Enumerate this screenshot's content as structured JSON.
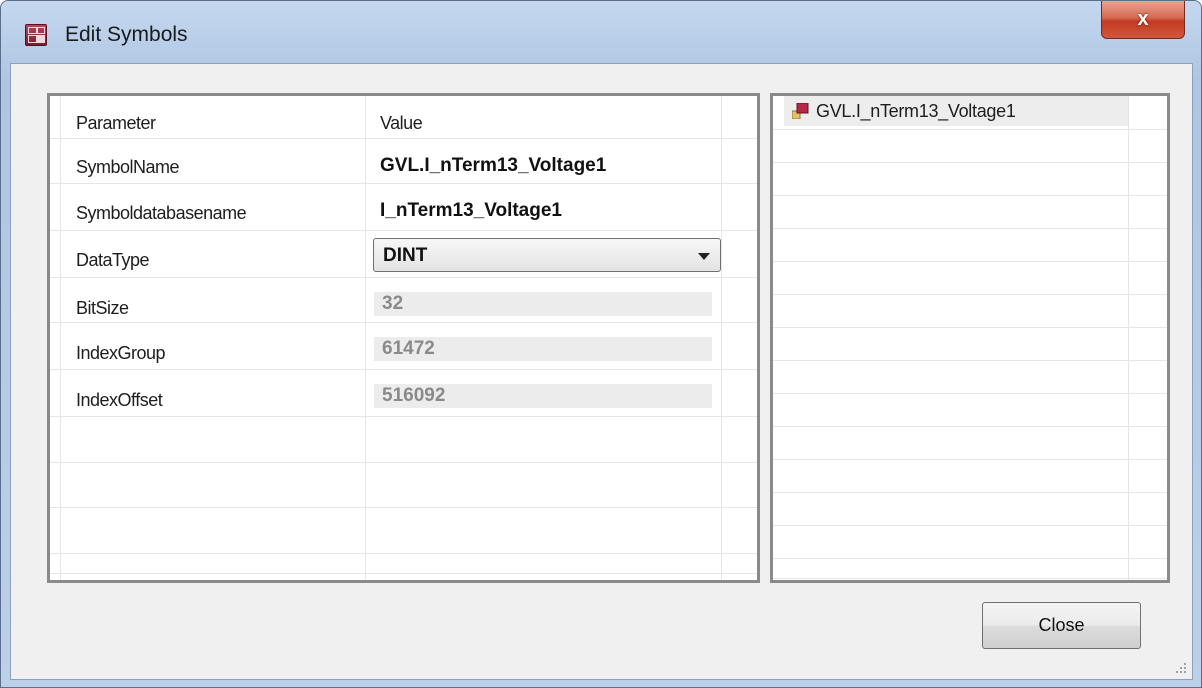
{
  "window": {
    "title": "Edit Symbols",
    "close_glyph": "x"
  },
  "grid": {
    "headers": {
      "parameter": "Parameter",
      "value": "Value"
    },
    "rows": [
      {
        "param": "SymbolName",
        "value": "GVL.I_nTerm13_Voltage1",
        "kind": "text"
      },
      {
        "param": "Symboldatabasename",
        "value": "I_nTerm13_Voltage1",
        "kind": "text"
      },
      {
        "param": "DataType",
        "value": "DINT",
        "kind": "combo"
      },
      {
        "param": "BitSize",
        "value": "32",
        "kind": "readonly"
      },
      {
        "param": "IndexGroup",
        "value": "61472",
        "kind": "readonly"
      },
      {
        "param": "IndexOffset",
        "value": "516092",
        "kind": "readonly"
      }
    ]
  },
  "tree": {
    "items": [
      {
        "label": "GVL.I_nTerm13_Voltage1",
        "icon": "symbol-icon"
      }
    ]
  },
  "buttons": {
    "close_label": "Close"
  },
  "colors": {
    "titlebar": "#b9cfe9",
    "close_button_red": "#c13a22",
    "app_icon": "#7a1c2e",
    "readonly_text": "#8a8a8a"
  }
}
